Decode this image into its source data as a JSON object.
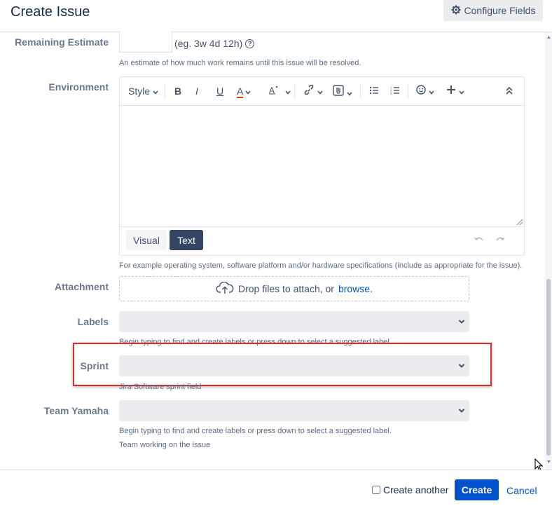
{
  "header": {
    "title": "Create Issue",
    "configure_label": "Configure Fields"
  },
  "remaining_estimate": {
    "label": "Remaining Estimate",
    "value": "",
    "hint": "(eg. 3w 4d 12h)",
    "description": "An estimate of how much work remains until this issue will be resolved."
  },
  "environment": {
    "label": "Environment",
    "toolbar": {
      "style_label": "Style",
      "bold": "B",
      "italic": "I",
      "underline": "U",
      "text_color": "A"
    },
    "content": "",
    "modes": [
      "Visual",
      "Text"
    ],
    "active_mode": "Text",
    "description": "For example operating system, software platform and/or hardware specifications (include as appropriate for the issue)."
  },
  "attachment": {
    "label": "Attachment",
    "drop_text": "Drop files to attach, or",
    "browse_link": "browse."
  },
  "labels": {
    "label": "Labels",
    "description": "Begin typing to find and create labels or press down to select a suggested label."
  },
  "sprint": {
    "label": "Sprint",
    "description": "Jira Software sprint field"
  },
  "team": {
    "label": "Team Yamaha",
    "description": "Begin typing to find and create labels or press down to select a suggested label.",
    "description2": "Team working on the issue"
  },
  "footer": {
    "create_another_label": "Create another",
    "create_label": "Create",
    "cancel_label": "Cancel"
  },
  "colors": {
    "primary": "#0052cc",
    "highlight": "#d92d2d",
    "text_color_underline": "#de350b"
  }
}
